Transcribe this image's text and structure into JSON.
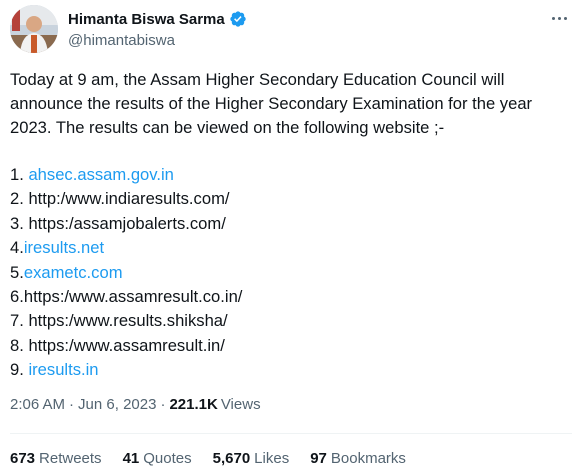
{
  "tweet": {
    "author": {
      "name": "Himanta Biswa Sarma",
      "handle": "@himantabiswa",
      "verified": true,
      "verified_color": "#1d9bf0"
    },
    "text": "Today at 9 am, the Assam Higher Secondary Education Council will announce the results of the Higher Secondary Examination for the year 2023. The results can be viewed on the following website ;-",
    "list": [
      {
        "prefix": "1. ",
        "text": "ahsec.assam.gov.in",
        "is_link": true
      },
      {
        "prefix": "2. ",
        "text": "http:/www.indiaresults.com/",
        "is_link": false
      },
      {
        "prefix": "3. ",
        "text": "https:/assamjobalerts.com/",
        "is_link": false
      },
      {
        "prefix": "4.",
        "text": "iresults.net",
        "is_link": true
      },
      {
        "prefix": "5.",
        "text": "exametc.com",
        "is_link": true
      },
      {
        "prefix": "6.",
        "text": "https:/www.assamresult.co.in/",
        "is_link": false
      },
      {
        "prefix": "7. ",
        "text": "https:/www.results.shiksha/",
        "is_link": false
      },
      {
        "prefix": "8. ",
        "text": "https:/www.assamresult.in/",
        "is_link": false
      },
      {
        "prefix": "9. ",
        "text": "iresults.in",
        "is_link": true
      }
    ],
    "meta": {
      "time": "2:06 AM",
      "separator": "·",
      "date": "Jun 6, 2023",
      "views_count": "221.1K",
      "views_label": "Views"
    },
    "stats": [
      {
        "count": "673",
        "label": "Retweets"
      },
      {
        "count": "41",
        "label": "Quotes"
      },
      {
        "count": "5,670",
        "label": "Likes"
      },
      {
        "count": "97",
        "label": "Bookmarks"
      }
    ],
    "link_color": "#1d9bf0",
    "more_icon": "more-horizontal-icon"
  }
}
